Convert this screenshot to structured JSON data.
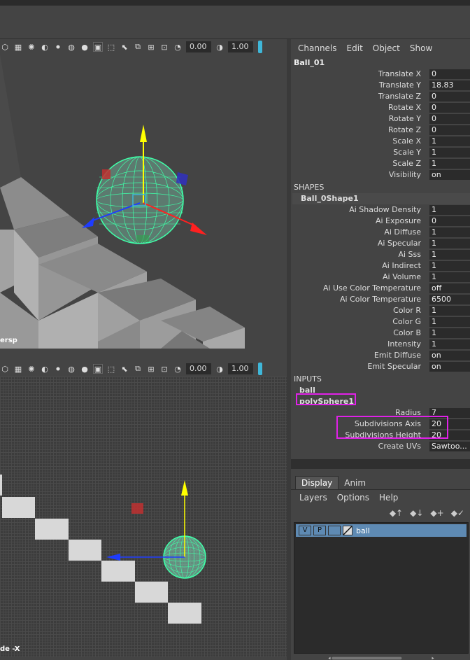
{
  "viewport_top": {
    "label": "ersp",
    "field1": "0.00",
    "field2": "1.00"
  },
  "viewport_bottom": {
    "label": "de -X",
    "field1": "0.00",
    "field2": "1.00"
  },
  "channel_box": {
    "menu": [
      "Channels",
      "Edit",
      "Object",
      "Show"
    ],
    "object_name": "Ball_01",
    "transform": [
      {
        "label": "Translate X",
        "value": "0"
      },
      {
        "label": "Translate Y",
        "value": "18.83"
      },
      {
        "label": "Translate Z",
        "value": "0"
      },
      {
        "label": "Rotate X",
        "value": "0"
      },
      {
        "label": "Rotate Y",
        "value": "0"
      },
      {
        "label": "Rotate Z",
        "value": "0"
      },
      {
        "label": "Scale X",
        "value": "1"
      },
      {
        "label": "Scale Y",
        "value": "1"
      },
      {
        "label": "Scale Z",
        "value": "1"
      },
      {
        "label": "Visibility",
        "value": "on"
      }
    ],
    "shapes_header": "SHAPES",
    "shape_name": "Ball_0Shape1",
    "shape_attrs": [
      {
        "label": "Ai Shadow Density",
        "value": "1"
      },
      {
        "label": "Ai Exposure",
        "value": "0"
      },
      {
        "label": "Ai Diffuse",
        "value": "1"
      },
      {
        "label": "Ai Specular",
        "value": "1"
      },
      {
        "label": "Ai Sss",
        "value": "1"
      },
      {
        "label": "Ai Indirect",
        "value": "1"
      },
      {
        "label": "Ai Volume",
        "value": "1"
      },
      {
        "label": "Ai Use Color Temperature",
        "value": "off"
      },
      {
        "label": "Ai Color Temperature",
        "value": "6500"
      },
      {
        "label": "Color R",
        "value": "1"
      },
      {
        "label": "Color G",
        "value": "1"
      },
      {
        "label": "Color B",
        "value": "1"
      },
      {
        "label": "Intensity",
        "value": "1"
      },
      {
        "label": "Emit Diffuse",
        "value": "on"
      },
      {
        "label": "Emit Specular",
        "value": "on"
      }
    ],
    "inputs_header": "INPUTS",
    "input_ball": "ball",
    "input_poly": "polySphere1",
    "poly_attrs": [
      {
        "label": "Radius",
        "value": "7"
      },
      {
        "label": "Subdivisions Axis",
        "value": "20"
      },
      {
        "label": "Subdivisions Height",
        "value": "20"
      },
      {
        "label": "Create UVs",
        "value": "Sawtoo..."
      }
    ]
  },
  "layer_editor": {
    "tabs": [
      "Display",
      "Anim"
    ],
    "menu": [
      "Layers",
      "Options",
      "Help"
    ],
    "layer": {
      "v": "V",
      "p": "P",
      "name": "ball"
    }
  },
  "colors": {
    "highlight": "#e021e8",
    "wireframe": "#3fffa8",
    "layer_row": "#5e8ab3"
  }
}
